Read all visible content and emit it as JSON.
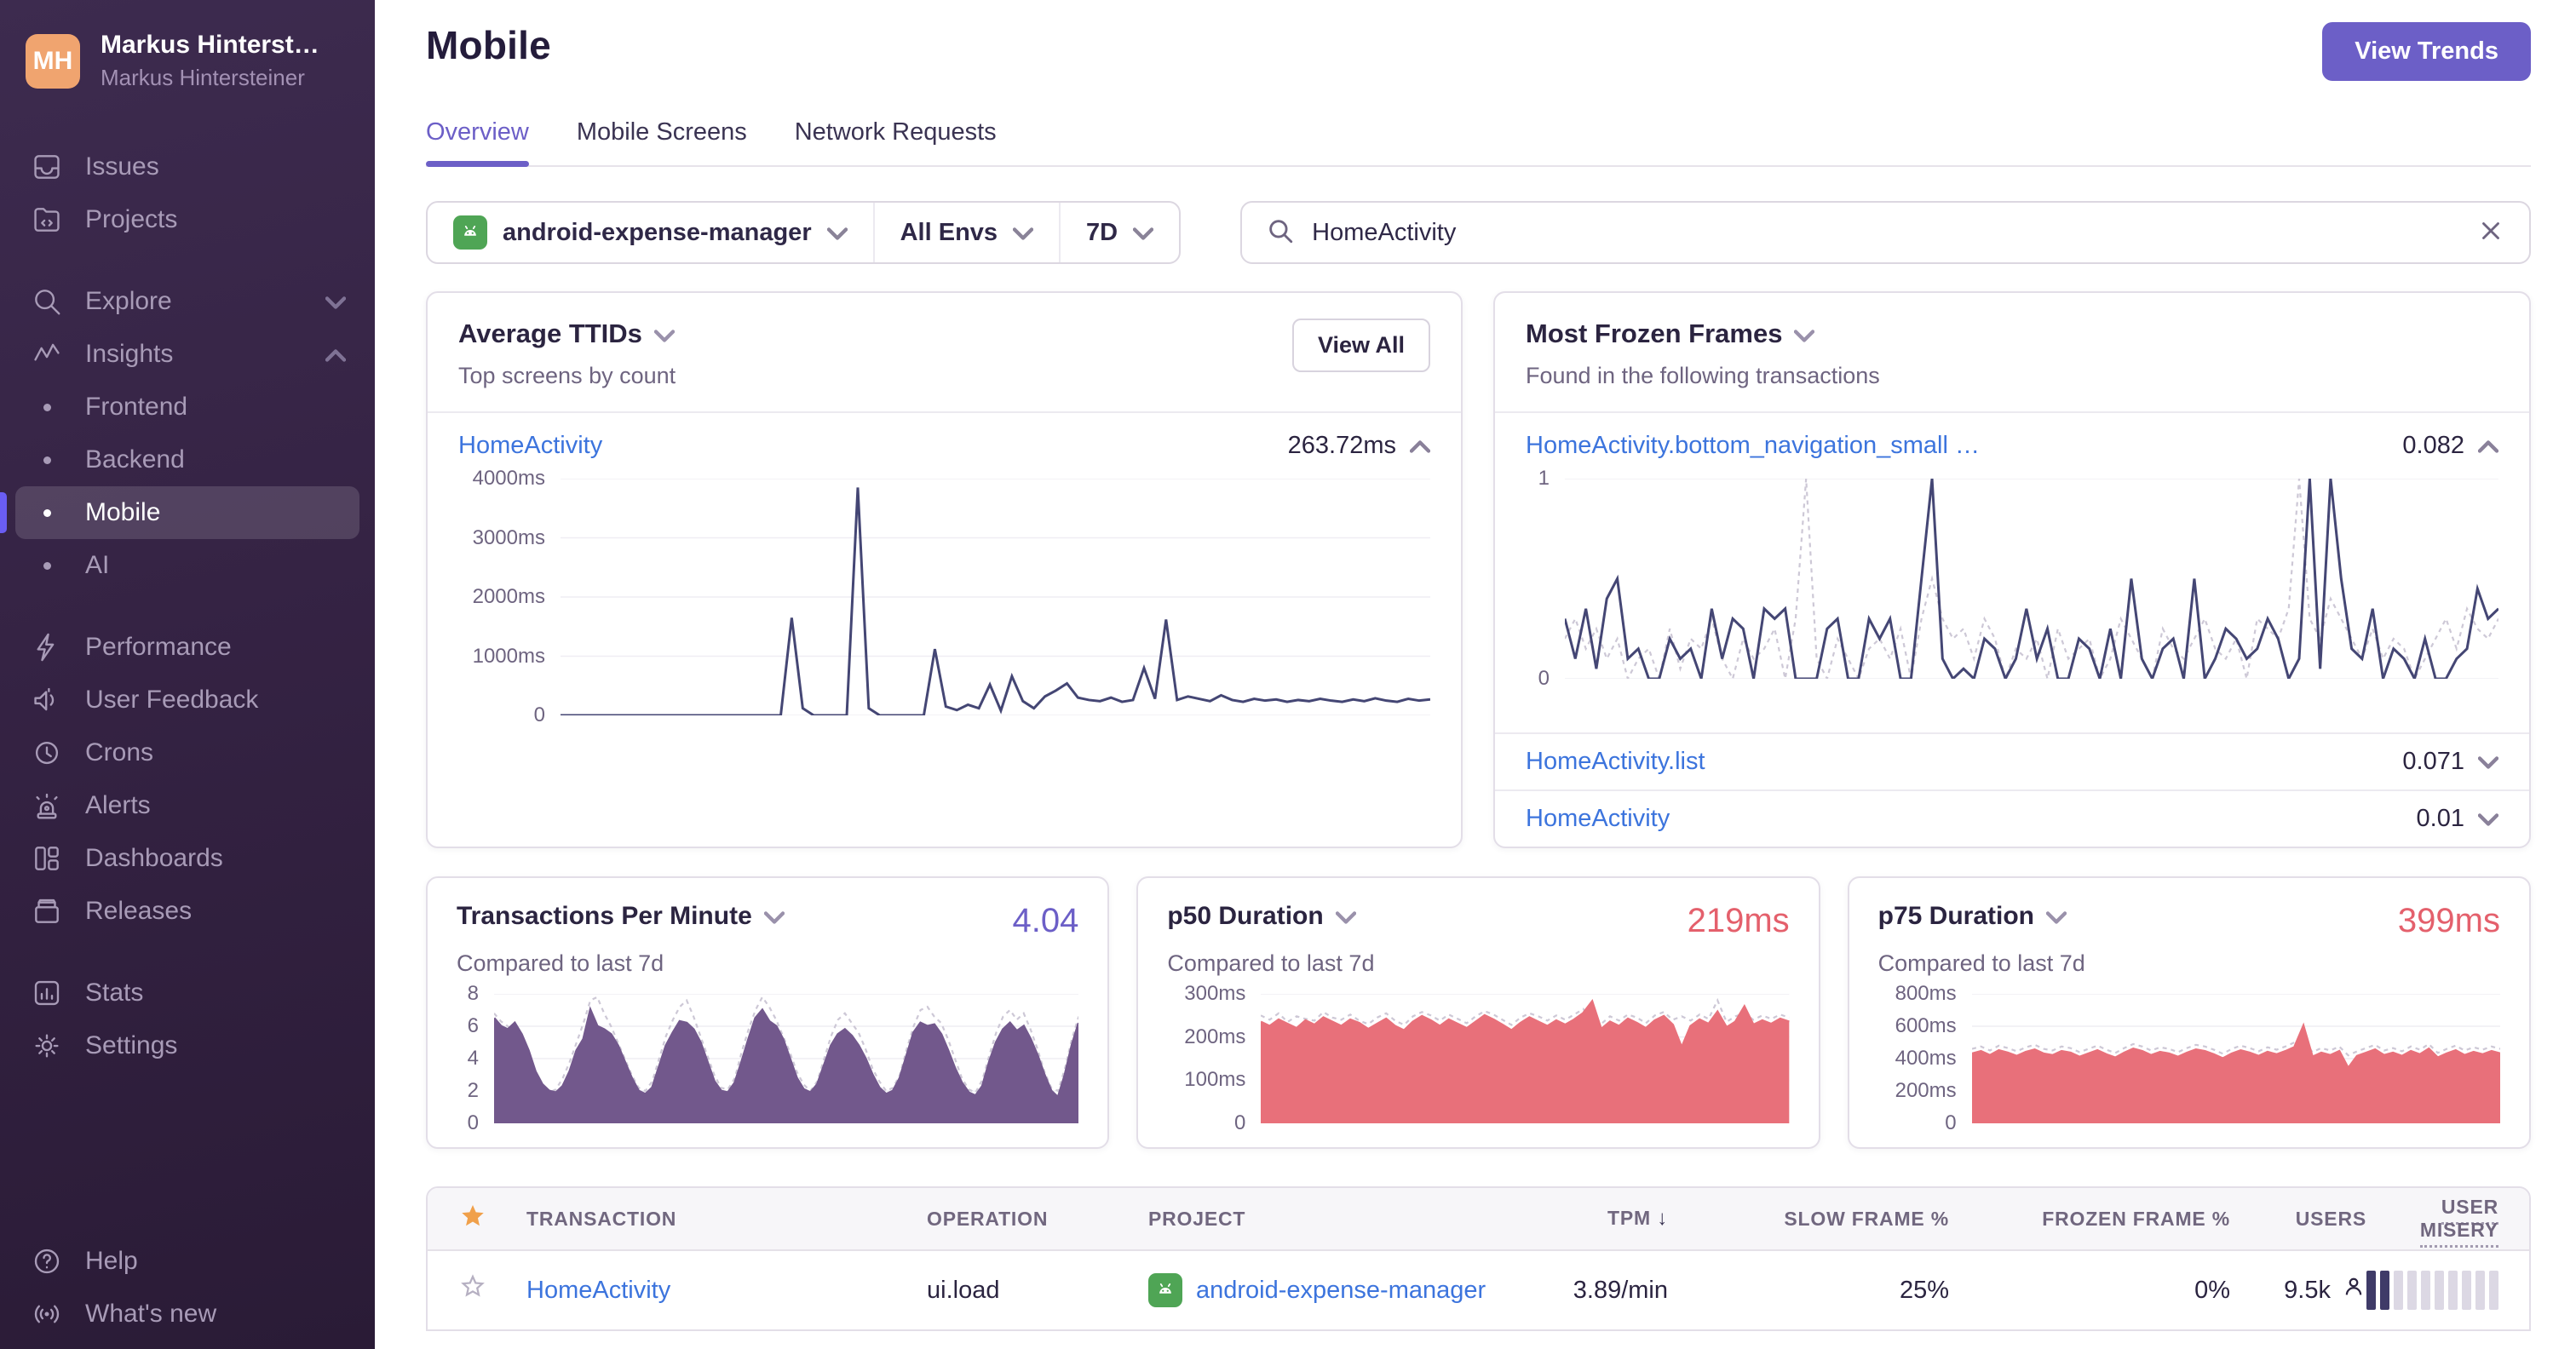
{
  "sidebar": {
    "user": {
      "initials": "MH",
      "name": "Markus Hinterst…",
      "org": "Markus Hintersteiner"
    },
    "primary": [
      {
        "label": "Issues"
      },
      {
        "label": "Projects"
      }
    ],
    "explore": {
      "label": "Explore"
    },
    "insights": {
      "label": "Insights"
    },
    "insights_children": [
      {
        "label": "Frontend"
      },
      {
        "label": "Backend"
      },
      {
        "label": "Mobile"
      },
      {
        "label": "AI"
      }
    ],
    "tools": [
      {
        "label": "Performance"
      },
      {
        "label": "User Feedback"
      },
      {
        "label": "Crons"
      },
      {
        "label": "Alerts"
      },
      {
        "label": "Dashboards"
      },
      {
        "label": "Releases"
      }
    ],
    "general": [
      {
        "label": "Stats"
      },
      {
        "label": "Settings"
      }
    ],
    "bottom": [
      {
        "label": "Help"
      },
      {
        "label": "What's new"
      }
    ]
  },
  "header": {
    "title": "Mobile",
    "view_trends_label": "View Trends"
  },
  "tabs": [
    {
      "label": "Overview"
    },
    {
      "label": "Mobile Screens"
    },
    {
      "label": "Network Requests"
    }
  ],
  "filters": {
    "project": "android-expense-manager",
    "environment": "All Envs",
    "date_range": "7D"
  },
  "search": {
    "value": "HomeActivity"
  },
  "ttids_card": {
    "title": "Average TTIDs",
    "subtitle": "Top screens by count",
    "view_all_label": "View All",
    "row": {
      "name": "HomeActivity",
      "value": "263.72ms"
    }
  },
  "frozen_card": {
    "title": "Most Frozen Frames",
    "subtitle": "Found in the following transactions",
    "rows": [
      {
        "name": "HomeActivity.bottom_navigation_small …",
        "value": "0.082"
      },
      {
        "name": "HomeActivity.list",
        "value": "0.071"
      },
      {
        "name": "HomeActivity",
        "value": "0.01"
      }
    ]
  },
  "tpm_card": {
    "title": "Transactions Per Minute",
    "value": "4.04",
    "subtitle": "Compared to last 7d"
  },
  "p50_card": {
    "title": "p50 Duration",
    "value": "219ms",
    "subtitle": "Compared to last 7d"
  },
  "p75_card": {
    "title": "p75 Duration",
    "value": "399ms",
    "subtitle": "Compared to last 7d"
  },
  "table": {
    "headers": {
      "transaction": "TRANSACTION",
      "operation": "OPERATION",
      "project": "PROJECT",
      "tpm": "TPM",
      "slow": "SLOW FRAME %",
      "frozen": "FROZEN FRAME %",
      "users": "USERS",
      "misery": "USER MISERY"
    },
    "row": {
      "transaction": "HomeActivity",
      "operation": "ui.load",
      "project": "android-expense-manager",
      "tpm": "3.89/min",
      "slow_frame_pct": "25%",
      "frozen_frame_pct": "0%",
      "users": "9.5k",
      "misery_filled": 2,
      "misery_total": 10
    }
  },
  "chart_data": [
    {
      "id": "ttid",
      "type": "line",
      "title": "Average TTIDs - HomeActivity",
      "xlabel": "",
      "ylabel": "ms",
      "ylim": [
        0,
        4000
      ],
      "grid": true,
      "legend": "none",
      "yticks": [
        "4000ms",
        "3000ms",
        "2000ms",
        "1000ms",
        "0"
      ],
      "series": [
        {
          "name": "TTID",
          "color": "#444674",
          "values": [
            0,
            0,
            0,
            0,
            0,
            0,
            0,
            0,
            0,
            0,
            0,
            0,
            0,
            0,
            0,
            0,
            0,
            0,
            0,
            0,
            0,
            1650,
            120,
            0,
            0,
            0,
            0,
            3850,
            120,
            0,
            0,
            0,
            0,
            0,
            1120,
            150,
            90,
            180,
            120,
            520,
            80,
            660,
            240,
            120,
            320,
            420,
            540,
            300,
            260,
            240,
            300,
            230,
            260,
            800,
            280,
            1620,
            260,
            320,
            280,
            240,
            340,
            260,
            230,
            280,
            250,
            270,
            230,
            260,
            240,
            280,
            250,
            230,
            270,
            240,
            290,
            250,
            230,
            280,
            250,
            270
          ]
        }
      ]
    },
    {
      "id": "frozen",
      "type": "line",
      "title": "Most Frozen Frames - HomeActivity.bottom_navigation_small",
      "xlabel": "",
      "ylabel": "",
      "ylim": [
        0,
        1
      ],
      "grid": true,
      "legend": "none",
      "yticks": [
        "1",
        "0"
      ],
      "series": [
        {
          "name": "previous period",
          "color": "#cdc8d6",
          "dash": true,
          "values": [
            0.2,
            0.3,
            0.15,
            0.25,
            0.1,
            0.2,
            0,
            0.1,
            0.15,
            0,
            0.25,
            0.05,
            0.2,
            0.15,
            0.3,
            0.1,
            0,
            0.2,
            0.1,
            0.15,
            0.25,
            0,
            0.3,
            1.0,
            0.1,
            0,
            0.2,
            0.1,
            0,
            0.15,
            0.2,
            0.1,
            0.25,
            0,
            0.3,
            0.5,
            0.3,
            0.2,
            0.25,
            0.1,
            0.3,
            0.2,
            0,
            0.15,
            0.1,
            0.2,
            0,
            0.25,
            0.1,
            0.15,
            0.2,
            0,
            0.1,
            0.3,
            0.2,
            0.1,
            0,
            0.25,
            0.15,
            0.1,
            0.2,
            0.3,
            0.15,
            0.1,
            0.2,
            0,
            0.3,
            0.25,
            0.2,
            0.35,
            1.0,
            0.3,
            0.2,
            0.4,
            0.3,
            0.2,
            0.1,
            0.25,
            0.1,
            0.2,
            0.15,
            0,
            0.1,
            0.2,
            0.3,
            0.15,
            0.35,
            0.25,
            0.2,
            0.3
          ]
        },
        {
          "name": "current period",
          "color": "#444674",
          "values": [
            0.3,
            0.1,
            0.35,
            0.05,
            0.4,
            0.5,
            0.1,
            0.15,
            0,
            0,
            0.2,
            0.1,
            0.15,
            0,
            0.35,
            0.1,
            0.3,
            0.25,
            0,
            0.35,
            0.3,
            0.35,
            0,
            0,
            0,
            0.25,
            0.3,
            0,
            0,
            0.3,
            0.2,
            0.3,
            0,
            0,
            0.5,
            1.0,
            0.1,
            0,
            0.05,
            0,
            0.2,
            0.15,
            0,
            0.1,
            0.35,
            0.1,
            0.25,
            0,
            0,
            0.2,
            0.15,
            0,
            0.25,
            0,
            0.5,
            0.1,
            0,
            0.15,
            0.2,
            0,
            0.5,
            0,
            0.1,
            0.25,
            0.2,
            0.1,
            0.15,
            0.3,
            0.2,
            0,
            0.1,
            1.0,
            0.05,
            1.0,
            0.5,
            0.15,
            0.1,
            0.35,
            0,
            0.15,
            0.1,
            0,
            0.2,
            0,
            0,
            0.1,
            0.15,
            0.45,
            0.3,
            0.35
          ]
        }
      ]
    },
    {
      "id": "tpm",
      "type": "area",
      "title": "Transactions Per Minute",
      "xlabel": "",
      "ylabel": "",
      "ylim": [
        0,
        8
      ],
      "grid": true,
      "legend": "none",
      "yticks": [
        "8",
        "6",
        "4",
        "2",
        "0"
      ],
      "series": [
        {
          "name": "previous period",
          "color": "#cdc8d6",
          "dash": true,
          "values": [
            6.8,
            6.3,
            6.0,
            5.6,
            5.0,
            4.0,
            3.0,
            2.2,
            1.9,
            2.1,
            2.8,
            3.8,
            5.0,
            6.2,
            7.6,
            7.8,
            6.8,
            6.0,
            5.0,
            4.0,
            3.0,
            2.2,
            2.0,
            2.6,
            4.0,
            5.4,
            6.4,
            7.2,
            7.6,
            6.6,
            5.4,
            4.2,
            3.0,
            2.2,
            2.1,
            2.8,
            4.4,
            5.8,
            7.0,
            7.8,
            7.2,
            6.4,
            5.4,
            4.4,
            3.2,
            2.4,
            2.0,
            2.6,
            4.0,
            5.4,
            6.4,
            6.8,
            6.2,
            5.6,
            4.6,
            3.4,
            2.6,
            2.0,
            2.2,
            3.0,
            4.6,
            6.0,
            7.0,
            7.2,
            6.6,
            6.2,
            5.2,
            4.0,
            2.8,
            2.1,
            1.9,
            2.7,
            4.2,
            5.6,
            6.6,
            7.0,
            6.4,
            6.8,
            5.8,
            4.6,
            3.2,
            2.2,
            2.0,
            3.4,
            5.2,
            6.6
          ]
        },
        {
          "name": "current period",
          "color": "#72588c",
          "fill": "#72588c",
          "values": [
            6.5,
            6.0,
            5.8,
            6.2,
            5.5,
            4.5,
            3.2,
            2.4,
            2.0,
            1.9,
            2.3,
            3.2,
            4.5,
            5.2,
            7.0,
            6.0,
            5.8,
            5.5,
            4.8,
            3.8,
            2.8,
            2.0,
            1.8,
            2.2,
            3.5,
            4.8,
            5.6,
            6.3,
            6.2,
            5.8,
            5.0,
            3.8,
            2.6,
            2.0,
            1.9,
            2.5,
            3.8,
            5.2,
            6.5,
            7.0,
            6.3,
            6.0,
            5.2,
            4.0,
            2.8,
            2.1,
            1.9,
            2.4,
            3.6,
            4.8,
            5.5,
            5.8,
            5.4,
            4.8,
            4.0,
            3.0,
            2.2,
            1.8,
            2.0,
            2.8,
            4.2,
            5.6,
            6.2,
            6.0,
            6.1,
            5.5,
            4.5,
            3.4,
            2.5,
            1.9,
            1.7,
            2.3,
            3.8,
            5.0,
            5.8,
            6.2,
            5.7,
            6.0,
            5.2,
            4.2,
            3.0,
            2.0,
            1.6,
            3.0,
            4.8,
            6.2
          ]
        }
      ]
    },
    {
      "id": "p50",
      "type": "area",
      "title": "p50 Duration",
      "xlabel": "",
      "ylabel": "ms",
      "ylim": [
        0,
        300
      ],
      "grid": true,
      "legend": "none",
      "yticks": [
        "300ms",
        "200ms",
        "100ms",
        "0"
      ],
      "series": [
        {
          "name": "previous period",
          "color": "#cdc8d6",
          "dash": true,
          "values": [
            250,
            240,
            255,
            235,
            248,
            242,
            238,
            258,
            245,
            240,
            252,
            238,
            230,
            245,
            255,
            238,
            228,
            248,
            258,
            250,
            238,
            252,
            242,
            232,
            248,
            260,
            252,
            240,
            228,
            245,
            255,
            248,
            238,
            250,
            240,
            252,
            265,
            242,
            230,
            248,
            238,
            252,
            245,
            232,
            250,
            258,
            240,
            248,
            238,
            252,
            242,
            285,
            235,
            248,
            255,
            240,
            250,
            242,
            252,
            245
          ]
        },
        {
          "name": "current period",
          "color": "#e8707a",
          "fill": "#e8707a",
          "values": [
            235,
            225,
            240,
            230,
            220,
            238,
            228,
            245,
            235,
            225,
            240,
            232,
            218,
            230,
            242,
            225,
            215,
            235,
            248,
            238,
            225,
            240,
            230,
            220,
            235,
            250,
            240,
            228,
            215,
            232,
            245,
            235,
            225,
            238,
            228,
            240,
            255,
            282,
            218,
            235,
            225,
            242,
            232,
            220,
            238,
            248,
            228,
            175,
            225,
            240,
            230,
            258,
            222,
            235,
            270,
            228,
            238,
            230,
            242,
            235
          ]
        }
      ]
    },
    {
      "id": "p75",
      "type": "area",
      "title": "p75 Duration",
      "xlabel": "",
      "ylabel": "ms",
      "ylim": [
        0,
        800
      ],
      "grid": true,
      "legend": "none",
      "yticks": [
        "800ms",
        "600ms",
        "400ms",
        "200ms",
        "0"
      ],
      "series": [
        {
          "name": "previous period",
          "color": "#cdc8d6",
          "dash": true,
          "values": [
            460,
            475,
            450,
            480,
            465,
            445,
            470,
            485,
            460,
            450,
            475,
            465,
            440,
            460,
            480,
            455,
            435,
            465,
            490,
            475,
            450,
            470,
            460,
            440,
            465,
            485,
            475,
            455,
            430,
            460,
            480,
            465,
            445,
            470,
            455,
            475,
            500,
            520,
            440,
            465,
            450,
            475,
            420,
            445,
            465,
            485,
            450,
            465,
            445,
            475,
            455,
            490,
            435,
            460,
            480,
            450,
            470,
            455,
            475,
            460
          ]
        },
        {
          "name": "current period",
          "color": "#e8707a",
          "fill": "#e8707a",
          "values": [
            430,
            445,
            420,
            450,
            435,
            415,
            440,
            455,
            430,
            420,
            445,
            435,
            410,
            430,
            450,
            425,
            405,
            435,
            460,
            445,
            420,
            440,
            430,
            410,
            435,
            455,
            445,
            425,
            400,
            430,
            450,
            435,
            415,
            440,
            425,
            445,
            470,
            600,
            410,
            435,
            420,
            445,
            340,
            415,
            435,
            455,
            420,
            435,
            415,
            445,
            425,
            460,
            405,
            430,
            450,
            420,
            440,
            425,
            445,
            430
          ]
        }
      ]
    }
  ]
}
